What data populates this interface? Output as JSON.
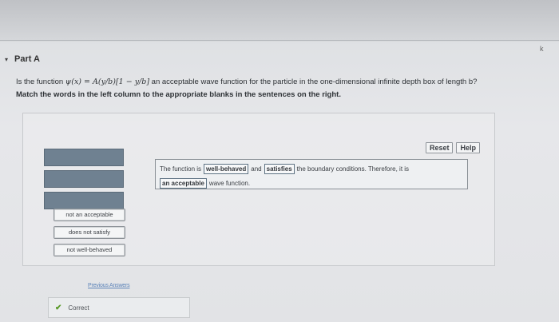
{
  "part": {
    "caret": "▾",
    "title": "Part A"
  },
  "question": {
    "prefix": "Is the function ",
    "math": "ψ(x) = A(y/b)[1 − y/b]",
    "suffix": " an acceptable wave function for the particle in the one-dimensional infinite depth box of length b?",
    "instruction": "Match the words in the left column to the appropriate blanks in the sentences on the right."
  },
  "toolbar": {
    "reset": "Reset",
    "help": "Help"
  },
  "word_bank": [
    "not an acceptable",
    "does not satisfy",
    "not well-behaved"
  ],
  "sentence": {
    "part1": "The function is",
    "blank1": "well-behaved",
    "part2": "and",
    "blank2": "satisfies",
    "part3": "the boundary conditions. Therefore, it is",
    "blank3": "an acceptable",
    "part4": "wave function."
  },
  "previous_answers": "Previous Answers",
  "result": {
    "check": "✔",
    "text": "Correct"
  },
  "stray_mark": "k"
}
